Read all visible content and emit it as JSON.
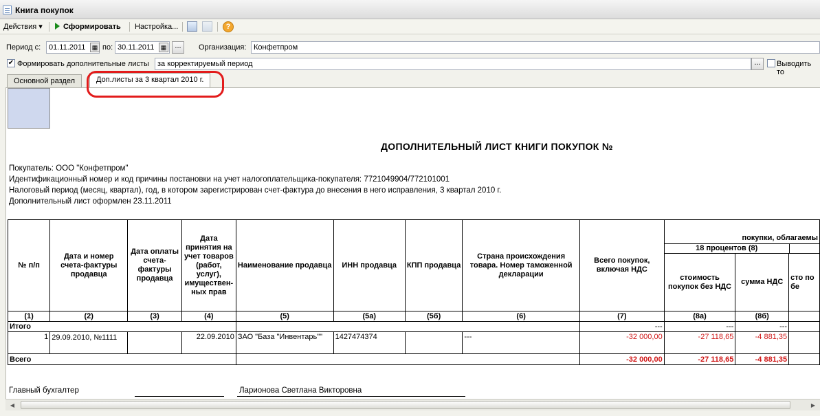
{
  "window": {
    "title": "Книга покупок"
  },
  "toolbar": {
    "actions": "Действия ▾",
    "generate": "Сформировать",
    "settings": "Настройка...",
    "help": "?"
  },
  "filters": {
    "period_from_label": "Период с:",
    "period_from": "01.11.2011",
    "period_to_label": "по:",
    "period_to": "30.11.2011",
    "dots": "...",
    "org_label": "Организация:",
    "org_value": "Конфетпром"
  },
  "options": {
    "extra_sheets_label": "Формировать дополнительные листы",
    "extra_sheets_checked": true,
    "extra_sheets_mode": "за корректируемый период",
    "dots": "...",
    "output_label": "Выводить то"
  },
  "tabs": [
    {
      "label": "Основной раздел",
      "active": false
    },
    {
      "label": "Доп.листы за 3 квартал 2010 г.",
      "active": true
    }
  ],
  "document": {
    "heading": "ДОПОЛНИТЕЛЬНЫЙ  ЛИСТ  КНИГИ ПОКУПОК  №",
    "lines": [
      "Покупатель:  ООО \"Конфетпром\"",
      "Идентификационный номер и код причины постановки на учет налогоплательщика-покупателя:  7721049904/772101001",
      "Налоговый период (месяц, квартал), год, в котором зарегистрирован счет-фактура до внесения в него исправления, 3 квартал 2010 г.",
      "Дополнительный лист оформлен 23.11.2011"
    ],
    "table": {
      "group_header": "покупки, облагаемы",
      "sub_group_header": "18 процентов (8)",
      "headers": {
        "c1": "№ п/п",
        "c2": "Дата и номер счета-фактуры продавца",
        "c3": "Дата оплаты счета-фактуры продавца",
        "c4": "Дата принятия на учет товаров (работ, услуг), имуществен-ных прав",
        "c5": "Наименование продавца",
        "c6": "ИНН продавца",
        "c7": "КПП продавца",
        "c8": "Страна происхождения товара. Номер таможенной декларации",
        "c9": "Всего покупок, включая НДС",
        "c10": "стоимость покупок без НДС",
        "c11": "сумма НДС",
        "c12": "сто по бе"
      },
      "nums": [
        "(1)",
        "(2)",
        "(3)",
        "(4)",
        "(5)",
        "(5а)",
        "(5б)",
        "(6)",
        "(7)",
        "(8а)",
        "(8б)",
        ""
      ],
      "itogo": {
        "label": "Итого",
        "c9": "---",
        "c10": "---",
        "c11": "---"
      },
      "row": {
        "n": "1",
        "c2": "29.09.2010, №1111",
        "c3": "",
        "c4": "22.09.2010",
        "c5": "ЗАО \"База \"Инвентарь\"\"",
        "c6": "1427474374",
        "c7": "",
        "c8": "---",
        "c9": "-32 000,00",
        "c10": "-27 118,65",
        "c11": "-4 881,35"
      },
      "vsego": {
        "label": "Всего",
        "c9": "-32 000,00",
        "c10": "-27 118,65",
        "c11": "-4 881,35"
      }
    },
    "signature": {
      "role": "Главный бухгалтер",
      "name": "Ларионова Светлана Викторовна"
    }
  },
  "colors": {
    "highlight": "#e21b1b",
    "negative": "#d01818"
  }
}
